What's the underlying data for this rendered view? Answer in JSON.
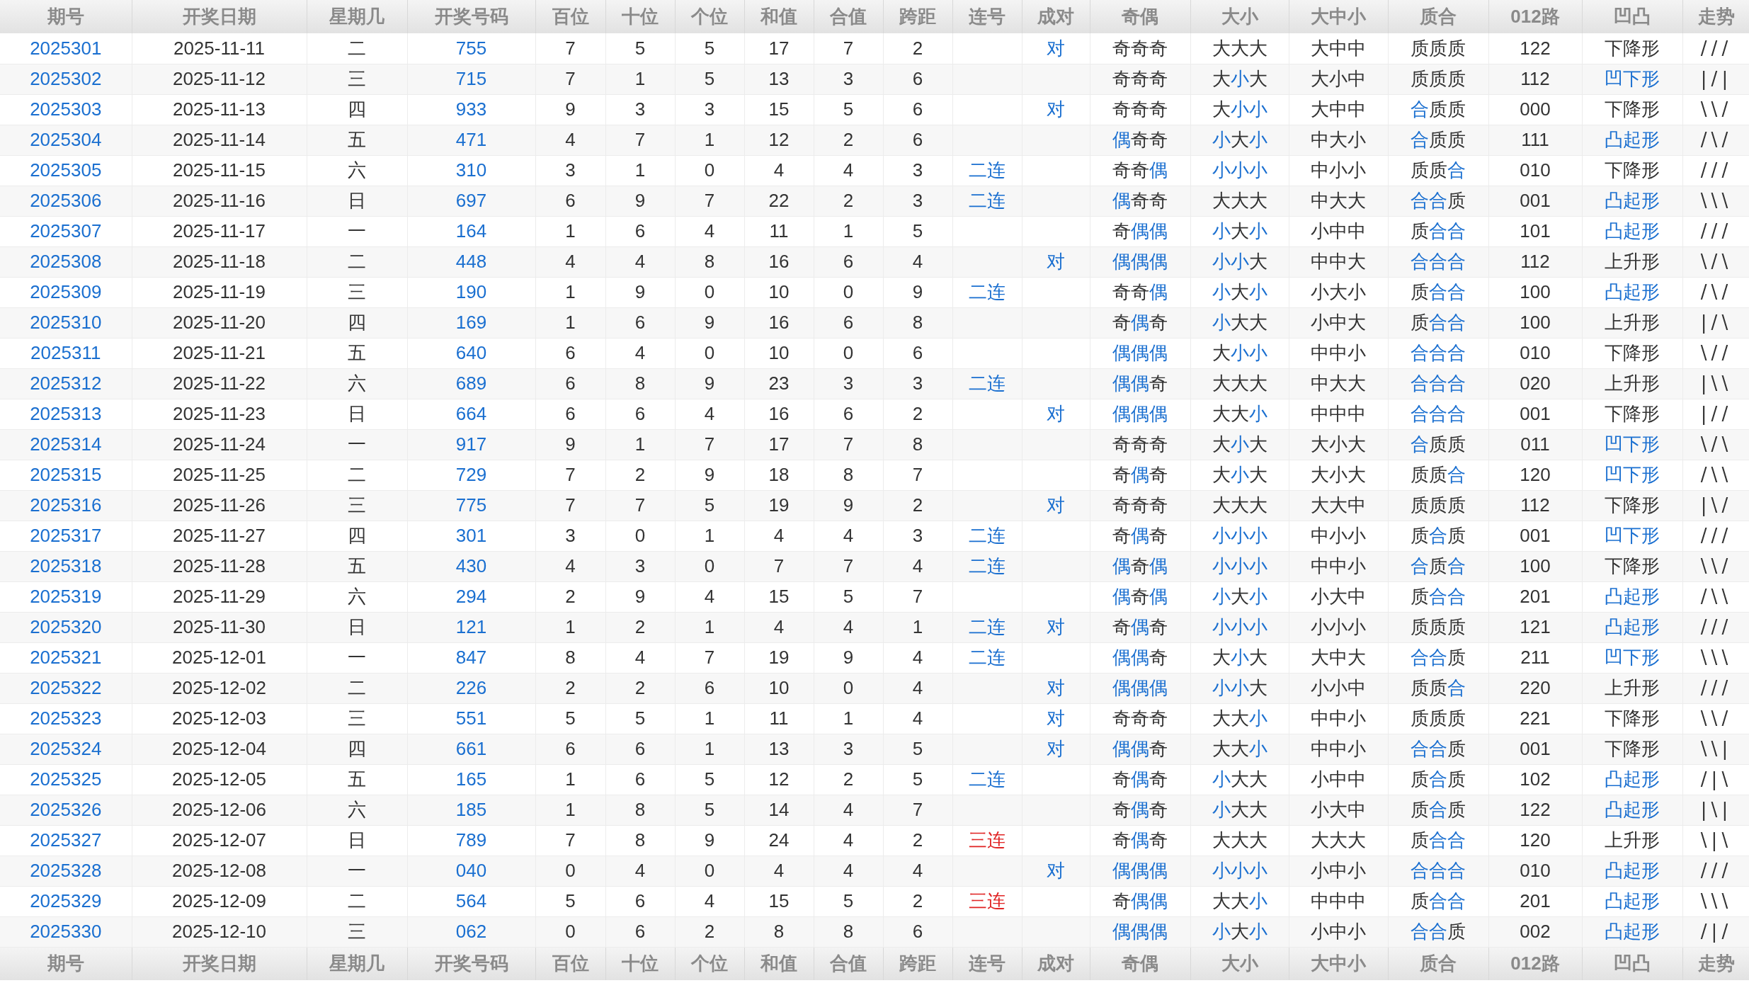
{
  "header": [
    "期号",
    "开奖日期",
    "星期几",
    "开奖号码",
    "百位",
    "十位",
    "个位",
    "和值",
    "合值",
    "跨距",
    "连号",
    "成对",
    "奇偶",
    "大小",
    "大中小",
    "质合",
    "012路",
    "凹凸",
    "走势"
  ],
  "rows": [
    {
      "issue": "2025301",
      "date": "2025-11-11",
      "weekday": "二",
      "number": "755",
      "hundreds": "7",
      "tens": "5",
      "units": "5",
      "sum": "17",
      "sum_tail": "7",
      "span": "2",
      "pair": "对",
      "odd_even": [
        {
          "text": "奇奇奇",
          "accent": false
        }
      ],
      "big_small": [
        {
          "text": "大大大",
          "accent": false
        }
      ],
      "big_mid_small": "大中中",
      "prime_composite": [
        {
          "text": "质质质",
          "accent": false
        }
      ],
      "road_012": "122",
      "shape": {
        "text": "下降形",
        "accent": false
      },
      "trend": "///"
    },
    {
      "issue": "2025302",
      "date": "2025-11-12",
      "weekday": "三",
      "number": "715",
      "hundreds": "7",
      "tens": "1",
      "units": "5",
      "sum": "13",
      "sum_tail": "3",
      "span": "6",
      "odd_even": [
        {
          "text": "奇奇奇",
          "accent": false
        }
      ],
      "big_small": [
        {
          "text": "大",
          "accent": false
        },
        {
          "text": "小",
          "accent": true
        },
        {
          "text": "大",
          "accent": false
        }
      ],
      "big_mid_small": "大小中",
      "prime_composite": [
        {
          "text": "质质质",
          "accent": false
        }
      ],
      "road_012": "112",
      "shape": {
        "text": "凹下形",
        "accent": true
      },
      "trend": "|/|"
    },
    {
      "issue": "2025303",
      "date": "2025-11-13",
      "weekday": "四",
      "number": "933",
      "hundreds": "9",
      "tens": "3",
      "units": "3",
      "sum": "15",
      "sum_tail": "5",
      "span": "6",
      "pair": "对",
      "odd_even": [
        {
          "text": "奇奇奇",
          "accent": false
        }
      ],
      "big_small": [
        {
          "text": "大",
          "accent": false
        },
        {
          "text": "小小",
          "accent": true
        }
      ],
      "big_mid_small": "大中中",
      "prime_composite": [
        {
          "text": "合",
          "accent": true
        },
        {
          "text": "质质",
          "accent": false
        }
      ],
      "road_012": "000",
      "shape": {
        "text": "下降形",
        "accent": false
      },
      "trend": "\\\\/"
    },
    {
      "issue": "2025304",
      "date": "2025-11-14",
      "weekday": "五",
      "number": "471",
      "hundreds": "4",
      "tens": "7",
      "units": "1",
      "sum": "12",
      "sum_tail": "2",
      "span": "6",
      "odd_even": [
        {
          "text": "偶",
          "accent": true
        },
        {
          "text": "奇奇",
          "accent": false
        }
      ],
      "big_small": [
        {
          "text": "小",
          "accent": true
        },
        {
          "text": "大",
          "accent": false
        },
        {
          "text": "小",
          "accent": true
        }
      ],
      "big_mid_small": "中大小",
      "prime_composite": [
        {
          "text": "合",
          "accent": true
        },
        {
          "text": "质质",
          "accent": false
        }
      ],
      "road_012": "111",
      "shape": {
        "text": "凸起形",
        "accent": true
      },
      "trend": "/\\/"
    },
    {
      "issue": "2025305",
      "date": "2025-11-15",
      "weekday": "六",
      "number": "310",
      "hundreds": "3",
      "tens": "1",
      "units": "0",
      "sum": "4",
      "sum_tail": "4",
      "span": "3",
      "streak": {
        "text": "二连",
        "color": "#1a6fd0"
      },
      "odd_even": [
        {
          "text": "奇奇",
          "accent": false
        },
        {
          "text": "偶",
          "accent": true
        }
      ],
      "big_small": [
        {
          "text": "小小小",
          "accent": true
        }
      ],
      "big_mid_small": "中小小",
      "prime_composite": [
        {
          "text": "质质",
          "accent": false
        },
        {
          "text": "合",
          "accent": true
        }
      ],
      "road_012": "010",
      "shape": {
        "text": "下降形",
        "accent": false
      },
      "trend": "///"
    },
    {
      "issue": "2025306",
      "date": "2025-11-16",
      "weekday": "日",
      "number": "697",
      "hundreds": "6",
      "tens": "9",
      "units": "7",
      "sum": "22",
      "sum_tail": "2",
      "span": "3",
      "streak": {
        "text": "二连",
        "color": "#1a6fd0"
      },
      "odd_even": [
        {
          "text": "偶",
          "accent": true
        },
        {
          "text": "奇奇",
          "accent": false
        }
      ],
      "big_small": [
        {
          "text": "大大大",
          "accent": false
        }
      ],
      "big_mid_small": "中大大",
      "prime_composite": [
        {
          "text": "合合",
          "accent": true
        },
        {
          "text": "质",
          "accent": false
        }
      ],
      "road_012": "001",
      "shape": {
        "text": "凸起形",
        "accent": true
      },
      "trend": "\\\\\\"
    },
    {
      "issue": "2025307",
      "date": "2025-11-17",
      "weekday": "一",
      "number": "164",
      "hundreds": "1",
      "tens": "6",
      "units": "4",
      "sum": "11",
      "sum_tail": "1",
      "span": "5",
      "odd_even": [
        {
          "text": "奇",
          "accent": false
        },
        {
          "text": "偶偶",
          "accent": true
        }
      ],
      "big_small": [
        {
          "text": "小",
          "accent": true
        },
        {
          "text": "大",
          "accent": false
        },
        {
          "text": "小",
          "accent": true
        }
      ],
      "big_mid_small": "小中中",
      "prime_composite": [
        {
          "text": "质",
          "accent": false
        },
        {
          "text": "合合",
          "accent": true
        }
      ],
      "road_012": "101",
      "shape": {
        "text": "凸起形",
        "accent": true
      },
      "trend": "///"
    },
    {
      "issue": "2025308",
      "date": "2025-11-18",
      "weekday": "二",
      "number": "448",
      "hundreds": "4",
      "tens": "4",
      "units": "8",
      "sum": "16",
      "sum_tail": "6",
      "span": "4",
      "pair": "对",
      "odd_even": [
        {
          "text": "偶偶偶",
          "accent": true
        }
      ],
      "big_small": [
        {
          "text": "小小",
          "accent": true
        },
        {
          "text": "大",
          "accent": false
        }
      ],
      "big_mid_small": "中中大",
      "prime_composite": [
        {
          "text": "合合合",
          "accent": true
        }
      ],
      "road_012": "112",
      "shape": {
        "text": "上升形",
        "accent": false
      },
      "trend": "\\/\\"
    },
    {
      "issue": "2025309",
      "date": "2025-11-19",
      "weekday": "三",
      "number": "190",
      "hundreds": "1",
      "tens": "9",
      "units": "0",
      "sum": "10",
      "sum_tail": "0",
      "span": "9",
      "streak": {
        "text": "二连",
        "color": "#1a6fd0"
      },
      "odd_even": [
        {
          "text": "奇奇",
          "accent": false
        },
        {
          "text": "偶",
          "accent": true
        }
      ],
      "big_small": [
        {
          "text": "小",
          "accent": true
        },
        {
          "text": "大",
          "accent": false
        },
        {
          "text": "小",
          "accent": true
        }
      ],
      "big_mid_small": "小大小",
      "prime_composite": [
        {
          "text": "质",
          "accent": false
        },
        {
          "text": "合合",
          "accent": true
        }
      ],
      "road_012": "100",
      "shape": {
        "text": "凸起形",
        "accent": true
      },
      "trend": "/\\/"
    },
    {
      "issue": "2025310",
      "date": "2025-11-20",
      "weekday": "四",
      "number": "169",
      "hundreds": "1",
      "tens": "6",
      "units": "9",
      "sum": "16",
      "sum_tail": "6",
      "span": "8",
      "odd_even": [
        {
          "text": "奇",
          "accent": false
        },
        {
          "text": "偶",
          "accent": true
        },
        {
          "text": "奇",
          "accent": false
        }
      ],
      "big_small": [
        {
          "text": "小",
          "accent": true
        },
        {
          "text": "大大",
          "accent": false
        }
      ],
      "big_mid_small": "小中大",
      "prime_composite": [
        {
          "text": "质",
          "accent": false
        },
        {
          "text": "合合",
          "accent": true
        }
      ],
      "road_012": "100",
      "shape": {
        "text": "上升形",
        "accent": false
      },
      "trend": "|/\\"
    },
    {
      "issue": "2025311",
      "date": "2025-11-21",
      "weekday": "五",
      "number": "640",
      "hundreds": "6",
      "tens": "4",
      "units": "0",
      "sum": "10",
      "sum_tail": "0",
      "span": "6",
      "odd_even": [
        {
          "text": "偶偶偶",
          "accent": true
        }
      ],
      "big_small": [
        {
          "text": "大",
          "accent": false
        },
        {
          "text": "小小",
          "accent": true
        }
      ],
      "big_mid_small": "中中小",
      "prime_composite": [
        {
          "text": "合合合",
          "accent": true
        }
      ],
      "road_012": "010",
      "shape": {
        "text": "下降形",
        "accent": false
      },
      "trend": "\\//"
    },
    {
      "issue": "2025312",
      "date": "2025-11-22",
      "weekday": "六",
      "number": "689",
      "hundreds": "6",
      "tens": "8",
      "units": "9",
      "sum": "23",
      "sum_tail": "3",
      "span": "3",
      "streak": {
        "text": "二连",
        "color": "#1a6fd0"
      },
      "odd_even": [
        {
          "text": "偶偶",
          "accent": true
        },
        {
          "text": "奇",
          "accent": false
        }
      ],
      "big_small": [
        {
          "text": "大大大",
          "accent": false
        }
      ],
      "big_mid_small": "中大大",
      "prime_composite": [
        {
          "text": "合合合",
          "accent": true
        }
      ],
      "road_012": "020",
      "shape": {
        "text": "上升形",
        "accent": false
      },
      "trend": "|\\\\"
    },
    {
      "issue": "2025313",
      "date": "2025-11-23",
      "weekday": "日",
      "number": "664",
      "hundreds": "6",
      "tens": "6",
      "units": "4",
      "sum": "16",
      "sum_tail": "6",
      "span": "2",
      "pair": "对",
      "odd_even": [
        {
          "text": "偶偶偶",
          "accent": true
        }
      ],
      "big_small": [
        {
          "text": "大大",
          "accent": false
        },
        {
          "text": "小",
          "accent": true
        }
      ],
      "big_mid_small": "中中中",
      "prime_composite": [
        {
          "text": "合合合",
          "accent": true
        }
      ],
      "road_012": "001",
      "shape": {
        "text": "下降形",
        "accent": false
      },
      "trend": "|//"
    },
    {
      "issue": "2025314",
      "date": "2025-11-24",
      "weekday": "一",
      "number": "917",
      "hundreds": "9",
      "tens": "1",
      "units": "7",
      "sum": "17",
      "sum_tail": "7",
      "span": "8",
      "odd_even": [
        {
          "text": "奇奇奇",
          "accent": false
        }
      ],
      "big_small": [
        {
          "text": "大",
          "accent": false
        },
        {
          "text": "小",
          "accent": true
        },
        {
          "text": "大",
          "accent": false
        }
      ],
      "big_mid_small": "大小大",
      "prime_composite": [
        {
          "text": "合",
          "accent": true
        },
        {
          "text": "质质",
          "accent": false
        }
      ],
      "road_012": "011",
      "shape": {
        "text": "凹下形",
        "accent": true
      },
      "trend": "\\/\\"
    },
    {
      "issue": "2025315",
      "date": "2025-11-25",
      "weekday": "二",
      "number": "729",
      "hundreds": "7",
      "tens": "2",
      "units": "9",
      "sum": "18",
      "sum_tail": "8",
      "span": "7",
      "odd_even": [
        {
          "text": "奇",
          "accent": false
        },
        {
          "text": "偶",
          "accent": true
        },
        {
          "text": "奇",
          "accent": false
        }
      ],
      "big_small": [
        {
          "text": "大",
          "accent": false
        },
        {
          "text": "小",
          "accent": true
        },
        {
          "text": "大",
          "accent": false
        }
      ],
      "big_mid_small": "大小大",
      "prime_composite": [
        {
          "text": "质质",
          "accent": false
        },
        {
          "text": "合",
          "accent": true
        }
      ],
      "road_012": "120",
      "shape": {
        "text": "凹下形",
        "accent": true
      },
      "trend": "/\\\\"
    },
    {
      "issue": "2025316",
      "date": "2025-11-26",
      "weekday": "三",
      "number": "775",
      "hundreds": "7",
      "tens": "7",
      "units": "5",
      "sum": "19",
      "sum_tail": "9",
      "span": "2",
      "pair": "对",
      "odd_even": [
        {
          "text": "奇奇奇",
          "accent": false
        }
      ],
      "big_small": [
        {
          "text": "大大大",
          "accent": false
        }
      ],
      "big_mid_small": "大大中",
      "prime_composite": [
        {
          "text": "质质质",
          "accent": false
        }
      ],
      "road_012": "112",
      "shape": {
        "text": "下降形",
        "accent": false
      },
      "trend": "|\\/"
    },
    {
      "issue": "2025317",
      "date": "2025-11-27",
      "weekday": "四",
      "number": "301",
      "hundreds": "3",
      "tens": "0",
      "units": "1",
      "sum": "4",
      "sum_tail": "4",
      "span": "3",
      "streak": {
        "text": "二连",
        "color": "#1a6fd0"
      },
      "odd_even": [
        {
          "text": "奇",
          "accent": false
        },
        {
          "text": "偶",
          "accent": true
        },
        {
          "text": "奇",
          "accent": false
        }
      ],
      "big_small": [
        {
          "text": "小小小",
          "accent": true
        }
      ],
      "big_mid_small": "中小小",
      "prime_composite": [
        {
          "text": "质",
          "accent": false
        },
        {
          "text": "合",
          "accent": true
        },
        {
          "text": "质",
          "accent": false
        }
      ],
      "road_012": "001",
      "shape": {
        "text": "凹下形",
        "accent": true
      },
      "trend": "///"
    },
    {
      "issue": "2025318",
      "date": "2025-11-28",
      "weekday": "五",
      "number": "430",
      "hundreds": "4",
      "tens": "3",
      "units": "0",
      "sum": "7",
      "sum_tail": "7",
      "span": "4",
      "streak": {
        "text": "二连",
        "color": "#1a6fd0"
      },
      "odd_even": [
        {
          "text": "偶",
          "accent": true
        },
        {
          "text": "奇",
          "accent": false
        },
        {
          "text": "偶",
          "accent": true
        }
      ],
      "big_small": [
        {
          "text": "小小小",
          "accent": true
        }
      ],
      "big_mid_small": "中中小",
      "prime_composite": [
        {
          "text": "合",
          "accent": true
        },
        {
          "text": "质",
          "accent": false
        },
        {
          "text": "合",
          "accent": true
        }
      ],
      "road_012": "100",
      "shape": {
        "text": "下降形",
        "accent": false
      },
      "trend": "\\\\/"
    },
    {
      "issue": "2025319",
      "date": "2025-11-29",
      "weekday": "六",
      "number": "294",
      "hundreds": "2",
      "tens": "9",
      "units": "4",
      "sum": "15",
      "sum_tail": "5",
      "span": "7",
      "odd_even": [
        {
          "text": "偶",
          "accent": true
        },
        {
          "text": "奇",
          "accent": false
        },
        {
          "text": "偶",
          "accent": true
        }
      ],
      "big_small": [
        {
          "text": "小",
          "accent": true
        },
        {
          "text": "大",
          "accent": false
        },
        {
          "text": "小",
          "accent": true
        }
      ],
      "big_mid_small": "小大中",
      "prime_composite": [
        {
          "text": "质",
          "accent": false
        },
        {
          "text": "合合",
          "accent": true
        }
      ],
      "road_012": "201",
      "shape": {
        "text": "凸起形",
        "accent": true
      },
      "trend": "/\\\\"
    },
    {
      "issue": "2025320",
      "date": "2025-11-30",
      "weekday": "日",
      "number": "121",
      "hundreds": "1",
      "tens": "2",
      "units": "1",
      "sum": "4",
      "sum_tail": "4",
      "span": "1",
      "streak": {
        "text": "二连",
        "color": "#1a6fd0"
      },
      "pair": "对",
      "odd_even": [
        {
          "text": "奇",
          "accent": false
        },
        {
          "text": "偶",
          "accent": true
        },
        {
          "text": "奇",
          "accent": false
        }
      ],
      "big_small": [
        {
          "text": "小小小",
          "accent": true
        }
      ],
      "big_mid_small": "小小小",
      "prime_composite": [
        {
          "text": "质质质",
          "accent": false
        }
      ],
      "road_012": "121",
      "shape": {
        "text": "凸起形",
        "accent": true
      },
      "trend": "///"
    },
    {
      "issue": "2025321",
      "date": "2025-12-01",
      "weekday": "一",
      "number": "847",
      "hundreds": "8",
      "tens": "4",
      "units": "7",
      "sum": "19",
      "sum_tail": "9",
      "span": "4",
      "streak": {
        "text": "二连",
        "color": "#1a6fd0"
      },
      "odd_even": [
        {
          "text": "偶偶",
          "accent": true
        },
        {
          "text": "奇",
          "accent": false
        }
      ],
      "big_small": [
        {
          "text": "大",
          "accent": false
        },
        {
          "text": "小",
          "accent": true
        },
        {
          "text": "大",
          "accent": false
        }
      ],
      "big_mid_small": "大中大",
      "prime_composite": [
        {
          "text": "合合",
          "accent": true
        },
        {
          "text": "质",
          "accent": false
        }
      ],
      "road_012": "211",
      "shape": {
        "text": "凹下形",
        "accent": true
      },
      "trend": "\\\\\\"
    },
    {
      "issue": "2025322",
      "date": "2025-12-02",
      "weekday": "二",
      "number": "226",
      "hundreds": "2",
      "tens": "2",
      "units": "6",
      "sum": "10",
      "sum_tail": "0",
      "span": "4",
      "pair": "对",
      "odd_even": [
        {
          "text": "偶偶偶",
          "accent": true
        }
      ],
      "big_small": [
        {
          "text": "小小",
          "accent": true
        },
        {
          "text": "大",
          "accent": false
        }
      ],
      "big_mid_small": "小小中",
      "prime_composite": [
        {
          "text": "质质",
          "accent": false
        },
        {
          "text": "合",
          "accent": true
        }
      ],
      "road_012": "220",
      "shape": {
        "text": "上升形",
        "accent": false
      },
      "trend": "///"
    },
    {
      "issue": "2025323",
      "date": "2025-12-03",
      "weekday": "三",
      "number": "551",
      "hundreds": "5",
      "tens": "5",
      "units": "1",
      "sum": "11",
      "sum_tail": "1",
      "span": "4",
      "pair": "对",
      "odd_even": [
        {
          "text": "奇奇奇",
          "accent": false
        }
      ],
      "big_small": [
        {
          "text": "大大",
          "accent": false
        },
        {
          "text": "小",
          "accent": true
        }
      ],
      "big_mid_small": "中中小",
      "prime_composite": [
        {
          "text": "质质质",
          "accent": false
        }
      ],
      "road_012": "221",
      "shape": {
        "text": "下降形",
        "accent": false
      },
      "trend": "\\\\/"
    },
    {
      "issue": "2025324",
      "date": "2025-12-04",
      "weekday": "四",
      "number": "661",
      "hundreds": "6",
      "tens": "6",
      "units": "1",
      "sum": "13",
      "sum_tail": "3",
      "span": "5",
      "pair": "对",
      "odd_even": [
        {
          "text": "偶偶",
          "accent": true
        },
        {
          "text": "奇",
          "accent": false
        }
      ],
      "big_small": [
        {
          "text": "大大",
          "accent": false
        },
        {
          "text": "小",
          "accent": true
        }
      ],
      "big_mid_small": "中中小",
      "prime_composite": [
        {
          "text": "合合",
          "accent": true
        },
        {
          "text": "质",
          "accent": false
        }
      ],
      "road_012": "001",
      "shape": {
        "text": "下降形",
        "accent": false
      },
      "trend": "\\\\|"
    },
    {
      "issue": "2025325",
      "date": "2025-12-05",
      "weekday": "五",
      "number": "165",
      "hundreds": "1",
      "tens": "6",
      "units": "5",
      "sum": "12",
      "sum_tail": "2",
      "span": "5",
      "streak": {
        "text": "二连",
        "color": "#1a6fd0"
      },
      "odd_even": [
        {
          "text": "奇",
          "accent": false
        },
        {
          "text": "偶",
          "accent": true
        },
        {
          "text": "奇",
          "accent": false
        }
      ],
      "big_small": [
        {
          "text": "小",
          "accent": true
        },
        {
          "text": "大大",
          "accent": false
        }
      ],
      "big_mid_small": "小中中",
      "prime_composite": [
        {
          "text": "质",
          "accent": false
        },
        {
          "text": "合",
          "accent": true
        },
        {
          "text": "质",
          "accent": false
        }
      ],
      "road_012": "102",
      "shape": {
        "text": "凸起形",
        "accent": true
      },
      "trend": "/|\\"
    },
    {
      "issue": "2025326",
      "date": "2025-12-06",
      "weekday": "六",
      "number": "185",
      "hundreds": "1",
      "tens": "8",
      "units": "5",
      "sum": "14",
      "sum_tail": "4",
      "span": "7",
      "odd_even": [
        {
          "text": "奇",
          "accent": false
        },
        {
          "text": "偶",
          "accent": true
        },
        {
          "text": "奇",
          "accent": false
        }
      ],
      "big_small": [
        {
          "text": "小",
          "accent": true
        },
        {
          "text": "大大",
          "accent": false
        }
      ],
      "big_mid_small": "小大中",
      "prime_composite": [
        {
          "text": "质",
          "accent": false
        },
        {
          "text": "合",
          "accent": true
        },
        {
          "text": "质",
          "accent": false
        }
      ],
      "road_012": "122",
      "shape": {
        "text": "凸起形",
        "accent": true
      },
      "trend": "|\\|"
    },
    {
      "issue": "2025327",
      "date": "2025-12-07",
      "weekday": "日",
      "number": "789",
      "hundreds": "7",
      "tens": "8",
      "units": "9",
      "sum": "24",
      "sum_tail": "4",
      "span": "2",
      "streak": {
        "text": "三连",
        "color": "#e02424"
      },
      "odd_even": [
        {
          "text": "奇",
          "accent": false
        },
        {
          "text": "偶",
          "accent": true
        },
        {
          "text": "奇",
          "accent": false
        }
      ],
      "big_small": [
        {
          "text": "大大大",
          "accent": false
        }
      ],
      "big_mid_small": "大大大",
      "prime_composite": [
        {
          "text": "质",
          "accent": false
        },
        {
          "text": "合合",
          "accent": true
        }
      ],
      "road_012": "120",
      "shape": {
        "text": "上升形",
        "accent": false
      },
      "trend": "\\|\\"
    },
    {
      "issue": "2025328",
      "date": "2025-12-08",
      "weekday": "一",
      "number": "040",
      "hundreds": "0",
      "tens": "4",
      "units": "0",
      "sum": "4",
      "sum_tail": "4",
      "span": "4",
      "pair": "对",
      "odd_even": [
        {
          "text": "偶偶偶",
          "accent": true
        }
      ],
      "big_small": [
        {
          "text": "小小小",
          "accent": true
        }
      ],
      "big_mid_small": "小中小",
      "prime_composite": [
        {
          "text": "合合合",
          "accent": true
        }
      ],
      "road_012": "010",
      "shape": {
        "text": "凸起形",
        "accent": true
      },
      "trend": "///"
    },
    {
      "issue": "2025329",
      "date": "2025-12-09",
      "weekday": "二",
      "number": "564",
      "hundreds": "5",
      "tens": "6",
      "units": "4",
      "sum": "15",
      "sum_tail": "5",
      "span": "2",
      "streak": {
        "text": "三连",
        "color": "#e02424"
      },
      "odd_even": [
        {
          "text": "奇",
          "accent": false
        },
        {
          "text": "偶偶",
          "accent": true
        }
      ],
      "big_small": [
        {
          "text": "大大",
          "accent": false
        },
        {
          "text": "小",
          "accent": true
        }
      ],
      "big_mid_small": "中中中",
      "prime_composite": [
        {
          "text": "质",
          "accent": false
        },
        {
          "text": "合合",
          "accent": true
        }
      ],
      "road_012": "201",
      "shape": {
        "text": "凸起形",
        "accent": true
      },
      "trend": "\\\\\\"
    },
    {
      "issue": "2025330",
      "date": "2025-12-10",
      "weekday": "三",
      "number": "062",
      "hundreds": "0",
      "tens": "6",
      "units": "2",
      "sum": "8",
      "sum_tail": "8",
      "span": "6",
      "odd_even": [
        {
          "text": "偶偶偶",
          "accent": true
        }
      ],
      "big_small": [
        {
          "text": "小",
          "accent": true
        },
        {
          "text": "大",
          "accent": false
        },
        {
          "text": "小",
          "accent": true
        }
      ],
      "big_mid_small": "小中小",
      "prime_composite": [
        {
          "text": "合合",
          "accent": true
        },
        {
          "text": "质",
          "accent": false
        }
      ],
      "road_012": "002",
      "shape": {
        "text": "凸起形",
        "accent": true
      },
      "trend": "/|/"
    }
  ],
  "footer": [
    "期号",
    "开奖日期",
    "星期几",
    "开奖号码",
    "百位",
    "十位",
    "个位",
    "和值",
    "合值",
    "跨距",
    "连号",
    "成对",
    "奇偶",
    "大小",
    "大中小",
    "质合",
    "012路",
    "凹凸",
    "走势"
  ]
}
